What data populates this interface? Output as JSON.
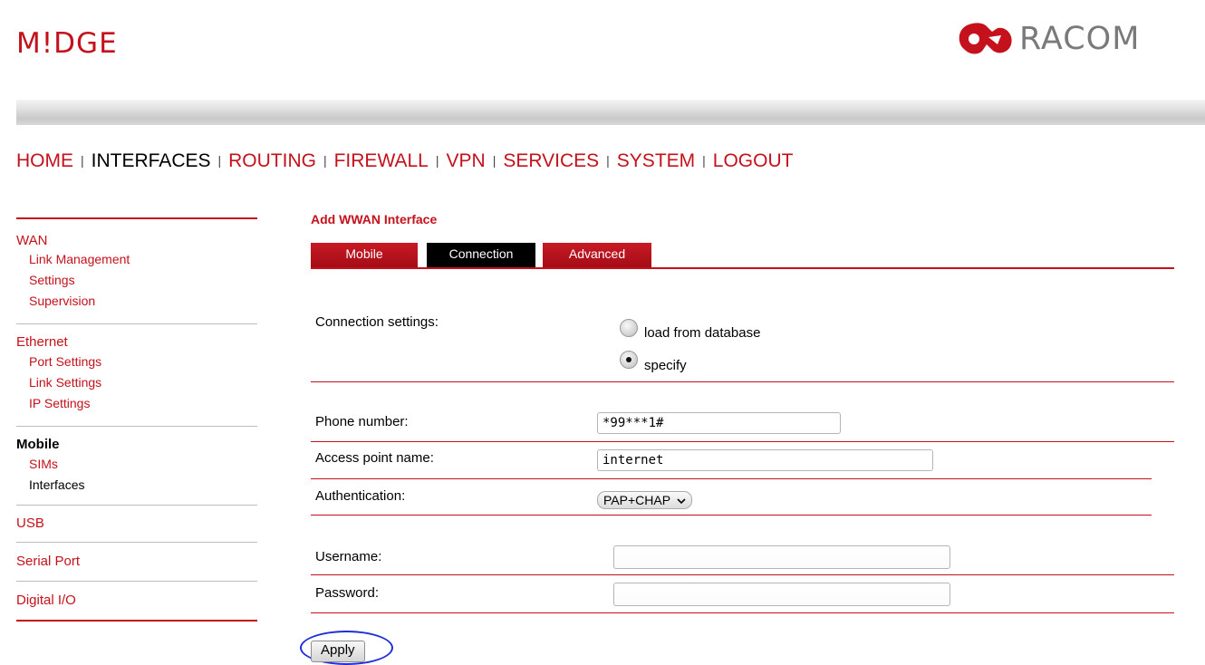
{
  "header": {
    "brand": "M!DGE",
    "vendor": "RACOM"
  },
  "topnav": {
    "items": [
      "HOME",
      "INTERFACES",
      "ROUTING",
      "FIREWALL",
      "VPN",
      "SERVICES",
      "SYSTEM",
      "LOGOUT"
    ],
    "active": "INTERFACES"
  },
  "sidebar": {
    "wan": {
      "title": "WAN",
      "items": [
        "Link Management",
        "Settings",
        "Supervision"
      ]
    },
    "ethernet": {
      "title": "Ethernet",
      "items": [
        "Port Settings",
        "Link Settings",
        "IP Settings"
      ]
    },
    "mobile": {
      "title": "Mobile",
      "items": [
        "SIMs",
        "Interfaces"
      ]
    },
    "usb": "USB",
    "serial": "Serial Port",
    "dio": "Digital I/O"
  },
  "form": {
    "title": "Add WWAN Interface",
    "tabs": [
      "Mobile",
      "Connection",
      "Advanced"
    ],
    "active_tab": "Connection",
    "connection_settings_label": "Connection settings:",
    "option_load": "load from database",
    "option_specify": "specify",
    "selected_option": "specify",
    "phone_label": "Phone number:",
    "phone_value": "*99***1#",
    "apn_label": "Access point name:",
    "apn_value": "internet",
    "auth_label": "Authentication:",
    "auth_value": "PAP+CHAP",
    "username_label": "Username:",
    "username_value": "",
    "password_label": "Password:",
    "password_value": "",
    "apply_label": "Apply"
  },
  "colors": {
    "accent": "#c4111b",
    "active_tab": "#000000",
    "highlight_ring": "#1f2ddb"
  }
}
